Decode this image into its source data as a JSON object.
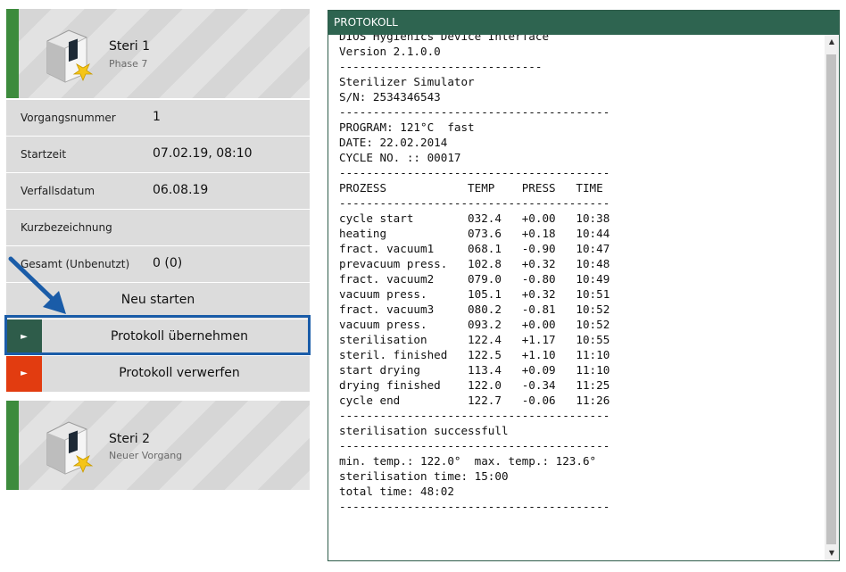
{
  "devices": [
    {
      "name": "Steri 1",
      "status": "Phase 7",
      "icon": "sterilizer-icon"
    },
    {
      "name": "Steri 2",
      "status": "Neuer Vorgang",
      "icon": "sterilizer-icon"
    }
  ],
  "details": [
    {
      "label": "Vorgangsnummer",
      "value": "1"
    },
    {
      "label": "Startzeit",
      "value": "07.02.19, 08:10"
    },
    {
      "label": "Verfallsdatum",
      "value": "06.08.19"
    },
    {
      "label": "Kurzbezeichnung",
      "value": ""
    },
    {
      "label": "Gesamt (Unbenutzt)",
      "value": "0 (0)"
    }
  ],
  "actions": {
    "restart": "Neu starten",
    "accept": "Protokoll übernehmen",
    "discard": "Protokoll verwerfen",
    "play_glyph": "►"
  },
  "protocol": {
    "title": "PROTOKOLL",
    "text": "DIOS Hygienics Device Interface\nVersion 2.1.0.0\n------------------------------\nSterilizer Simulator\nS/N: 2534346543\n----------------------------------------\nPROGRAM: 121°C  fast\nDATE: 22.02.2014\nCYCLE NO. :: 00017\n----------------------------------------\nPROZESS            TEMP    PRESS   TIME\n----------------------------------------\ncycle start        032.4   +0.00   10:38\nheating            073.6   +0.18   10:44\nfract. vacuum1     068.1   -0.90   10:47\nprevacuum press.   102.8   +0.32   10:48\nfract. vacuum2     079.0   -0.80   10:49\nvacuum press.      105.1   +0.32   10:51\nfract. vacuum3     080.2   -0.81   10:52\nvacuum press.      093.2   +0.00   10:52\nsterilisation      122.4   +1.17   10:55\nsteril. finished   122.5   +1.10   11:10\nstart drying       113.4   +0.09   11:10\ndrying finished    122.0   -0.34   11:25\ncycle end          122.7   -0.06   11:26\n----------------------------------------\nsterilisation successfull\n----------------------------------------\nmin. temp.: 122.0°  max. temp.: 123.6°\nsterilisation time: 15:00\ntotal time: 48:02\n----------------------------------------"
  },
  "colors": {
    "accent_green": "#3d8b3d",
    "header_green": "#2e6450",
    "discard_red": "#e23c10",
    "highlight_blue": "#1a5ca8"
  }
}
